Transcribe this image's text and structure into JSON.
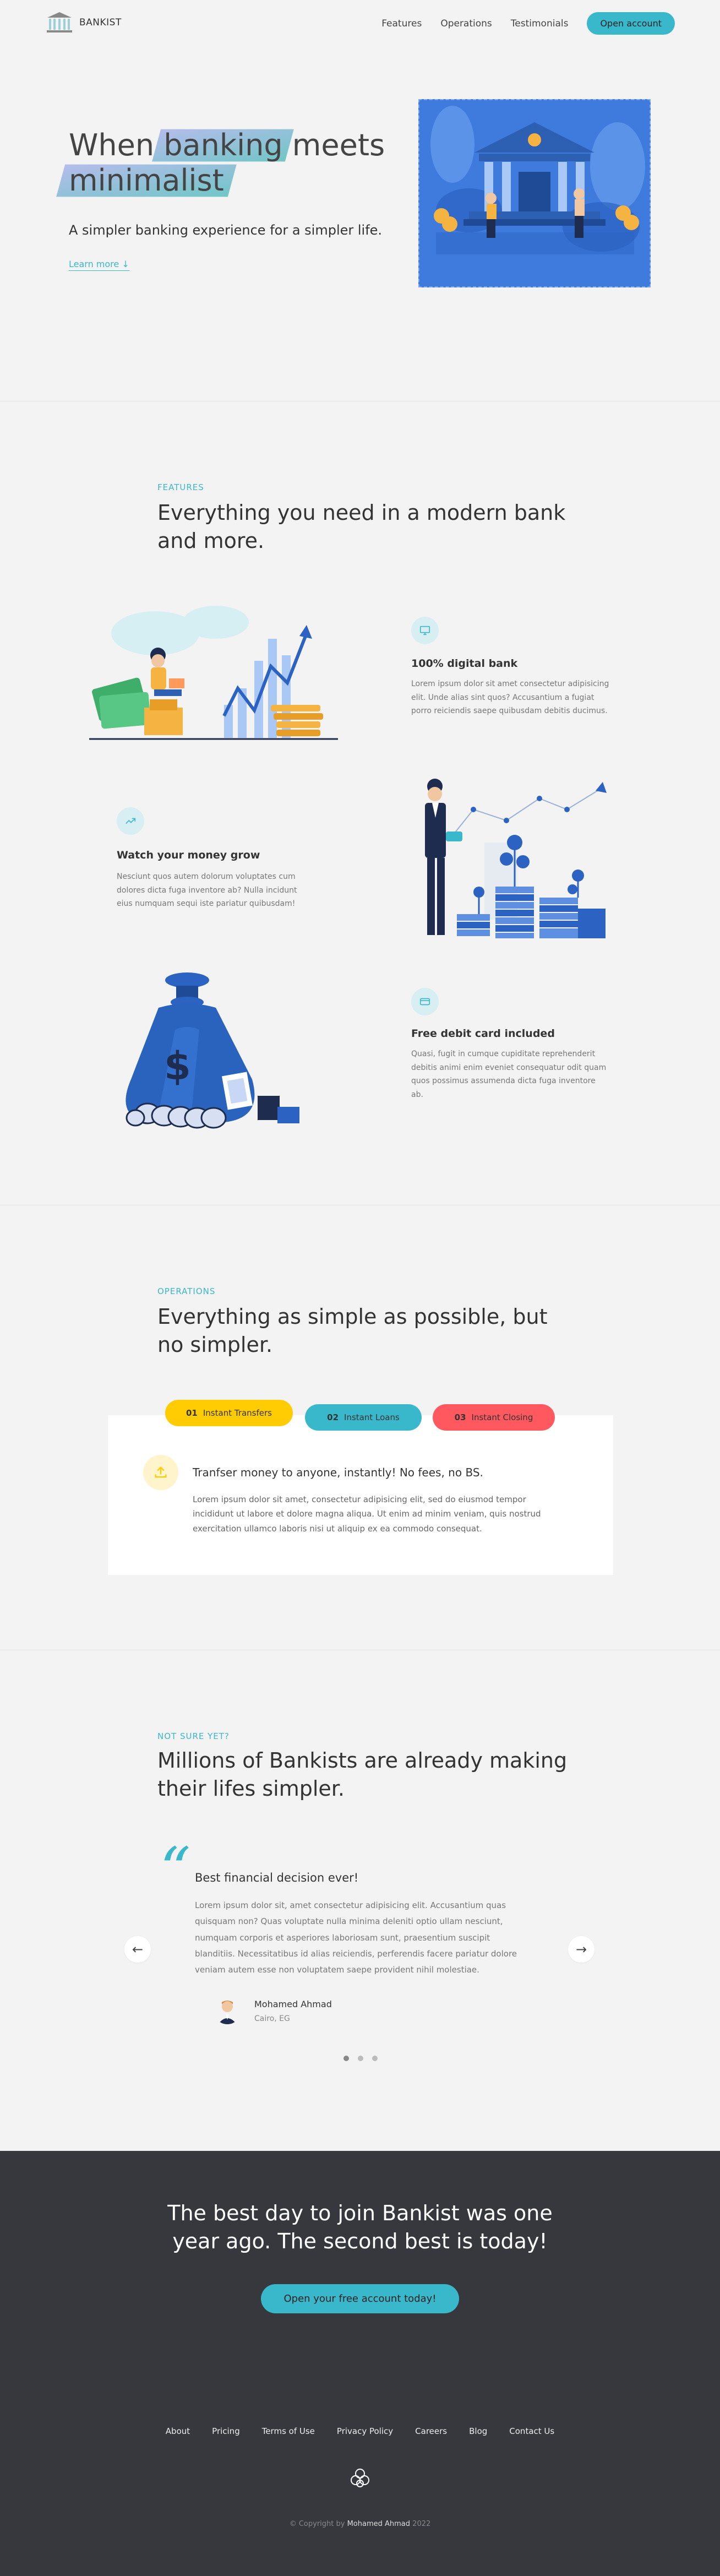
{
  "nav": {
    "brand": "BANKIST",
    "links": [
      "Features",
      "Operations",
      "Testimonials"
    ],
    "cta": "Open account"
  },
  "hero": {
    "title_part1": "When",
    "title_hl1": "banking",
    "title_part2": "meets",
    "title_hl2": "minimalist",
    "subtitle": "A simpler banking experience for a simpler life.",
    "learn_more": "Learn more ↓"
  },
  "features": {
    "label": "Features",
    "title": "Everything you need in a modern bank and more.",
    "items": [
      {
        "icon": "monitor-icon",
        "heading": "100% digital bank",
        "text": "Lorem ipsum dolor sit amet consectetur adipisicing elit. Unde alias sint quos? Accusantium a fugiat porro reiciendis saepe quibusdam debitis ducimus."
      },
      {
        "icon": "trend-up-icon",
        "heading": "Watch your money grow",
        "text": "Nesciunt quos autem dolorum voluptates cum dolores dicta fuga inventore ab? Nulla incidunt eius numquam sequi iste pariatur quibusdam!"
      },
      {
        "icon": "credit-card-icon",
        "heading": "Free debit card included",
        "text": "Quasi, fugit in cumque cupiditate reprehenderit debitis animi enim eveniet consequatur odit quam quos possimus assumenda dicta fuga inventore ab."
      }
    ]
  },
  "operations": {
    "label": "Operations",
    "title": "Everything as simple as possible, but no simpler.",
    "tabs": [
      {
        "num": "01",
        "label": "Instant Transfers",
        "color": "#ffcb03"
      },
      {
        "num": "02",
        "label": "Instant Loans",
        "color": "#39b8cb"
      },
      {
        "num": "03",
        "label": "Instant Closing",
        "color": "#ff585f"
      }
    ],
    "content_heading": "Tranfser money to anyone, instantly! No fees, no BS.",
    "content_text": "Lorem ipsum dolor sit amet, consectetur adipisicing elit, sed do eiusmod tempor incididunt ut labore et dolore magna aliqua. Ut enim ad minim veniam, quis nostrud exercitation ullamco laboris nisi ut aliquip ex ea commodo consequat."
  },
  "testimonials": {
    "label": "Not sure yet?",
    "title": "Millions of Bankists are already making their lifes simpler.",
    "quote_heading": "Best financial decision ever!",
    "quote_text": "Lorem ipsum dolor sit, amet consectetur adipisicing elit. Accusantium quas quisquam non? Quas voluptate nulla minima deleniti optio ullam nesciunt, numquam corporis et asperiores laboriosam sunt, praesentium suscipit blanditiis. Necessitatibus id alias reiciendis, perferendis facere pariatur dolore veniam autem esse non voluptatem saepe provident nihil molestiae.",
    "author": "Mohamed Ahmad",
    "location": "Cairo, EG"
  },
  "signup": {
    "title": "The best day to join Bankist was one year ago. The second best is today!",
    "cta": "Open your free account today!"
  },
  "footer": {
    "links": [
      "About",
      "Pricing",
      "Terms of Use",
      "Privacy Policy",
      "Careers",
      "Blog",
      "Contact Us"
    ],
    "copyright_prefix": "© Copyright by",
    "copyright_name": "Mohamed Ahmad",
    "copyright_year": "2022"
  },
  "colors": {
    "accent": "#39b8cb",
    "dark": "#37383d",
    "yellow": "#ffcb03",
    "red": "#ff585f"
  }
}
